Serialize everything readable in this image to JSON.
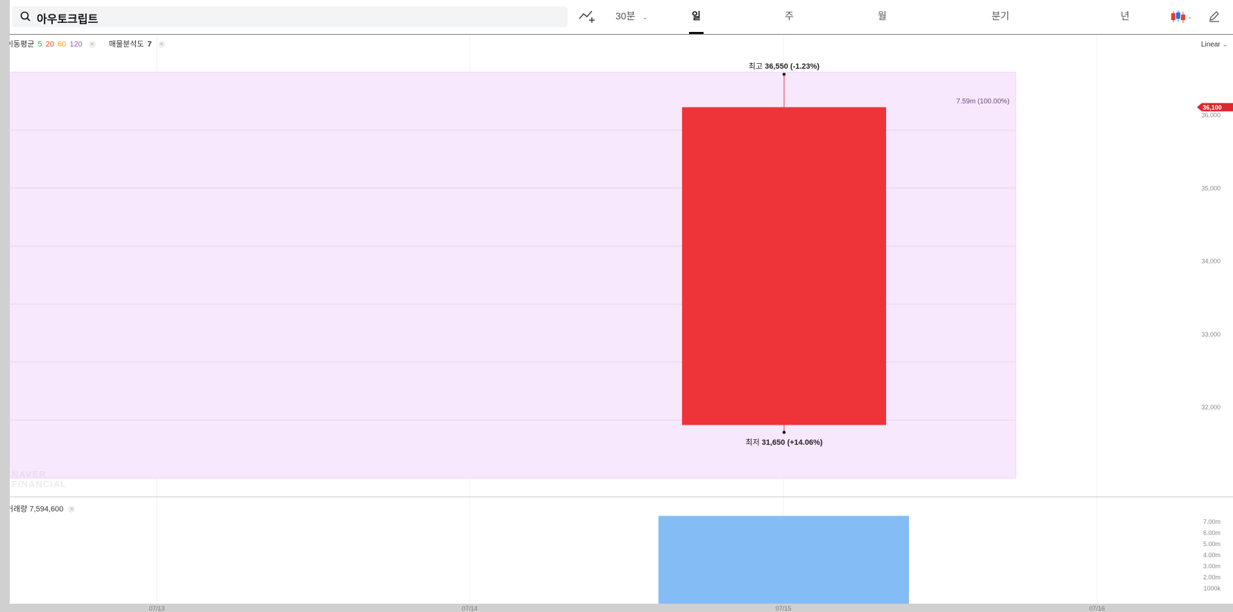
{
  "search": {
    "query": "아우토크립트"
  },
  "toolbar": {
    "interval": "30분",
    "tabs": [
      "일",
      "주",
      "월",
      "분기",
      "년"
    ],
    "active_tab": "일"
  },
  "indicators": {
    "ma_label": "이동평균",
    "ma_periods": [
      {
        "label": "5",
        "color": "#2bb24c"
      },
      {
        "label": "20",
        "color": "#e8412e"
      },
      {
        "label": "60",
        "color": "#f3a21a"
      },
      {
        "label": "120",
        "color": "#9b59b6"
      }
    ],
    "vp_label": "매물분석도",
    "vp_value": "7",
    "volume_label": "거래량",
    "volume_value": "7,594,600"
  },
  "scale_mode": "Linear",
  "watermark": [
    "NAVER",
    "FINANCIAL"
  ],
  "chart_data": [
    {
      "type": "candlestick",
      "x": "07/15",
      "open": 31750,
      "close": 36100,
      "high": 36550,
      "low": 31650,
      "high_label": "최고",
      "high_value": "36,550",
      "high_pct": "(-1.23%)",
      "low_label": "최저",
      "low_value": "31,650",
      "low_pct": "(+14.06%)",
      "current_price_label": "36,100",
      "volume_profile_label": "7.59m (100.00%)",
      "y_ticks": [
        "36,000",
        "35,000",
        "34,000",
        "33,000",
        "32,000"
      ],
      "x_ticks": [
        "07/13",
        "07/14",
        "07/15",
        "07/16"
      ],
      "colors": {
        "up": "#ee3439",
        "profile": "#f7e8fd",
        "current_badge": "#d9282f"
      }
    },
    {
      "type": "bar",
      "x": "07/15",
      "volume": 7594600,
      "y_ticks": [
        "7.00m",
        "6.00m",
        "5.00m",
        "4.00m",
        "3.00m",
        "2.00m",
        "1000k"
      ],
      "colors": {
        "bar": "#84bdf6"
      }
    }
  ]
}
